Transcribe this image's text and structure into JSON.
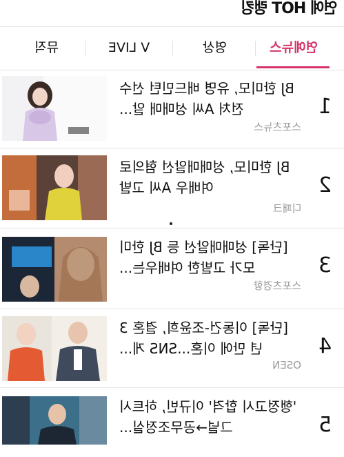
{
  "header": {
    "title": "연예 HOT 랭킹"
  },
  "tabs": [
    {
      "label": "연예뉴스",
      "active": true
    },
    {
      "label": "영상",
      "active": false
    },
    {
      "label": "V LIVE",
      "active": false
    },
    {
      "label": "뮤직",
      "active": false
    }
  ],
  "accent_color": "#d6336c",
  "articles": [
    {
      "rank": "1",
      "title": "BJ 한미모, 유명 배드민턴 선수 전처 A씨 성매매 알...",
      "source": "스포츠뉴스"
    },
    {
      "rank": "2",
      "title": "BJ 한미모, 성매매알선 혐의로 여배우 A씨 고발",
      "source": "디패크"
    },
    {
      "rank": "3",
      "title": "[단독] 성매매알선 등 BJ 한미모가 고발한 여배우는...",
      "source": "스포츠경향"
    },
    {
      "rank": "4",
      "title": "[단독] 이동건-조윤희, 결혼 3년 만에 이혼...SNS 게...",
      "source": "OSEN"
    },
    {
      "rank": "5",
      "title": "'행정고시 합격' 이규빈, 하트시그널→공무조정실...",
      "source": ""
    }
  ]
}
